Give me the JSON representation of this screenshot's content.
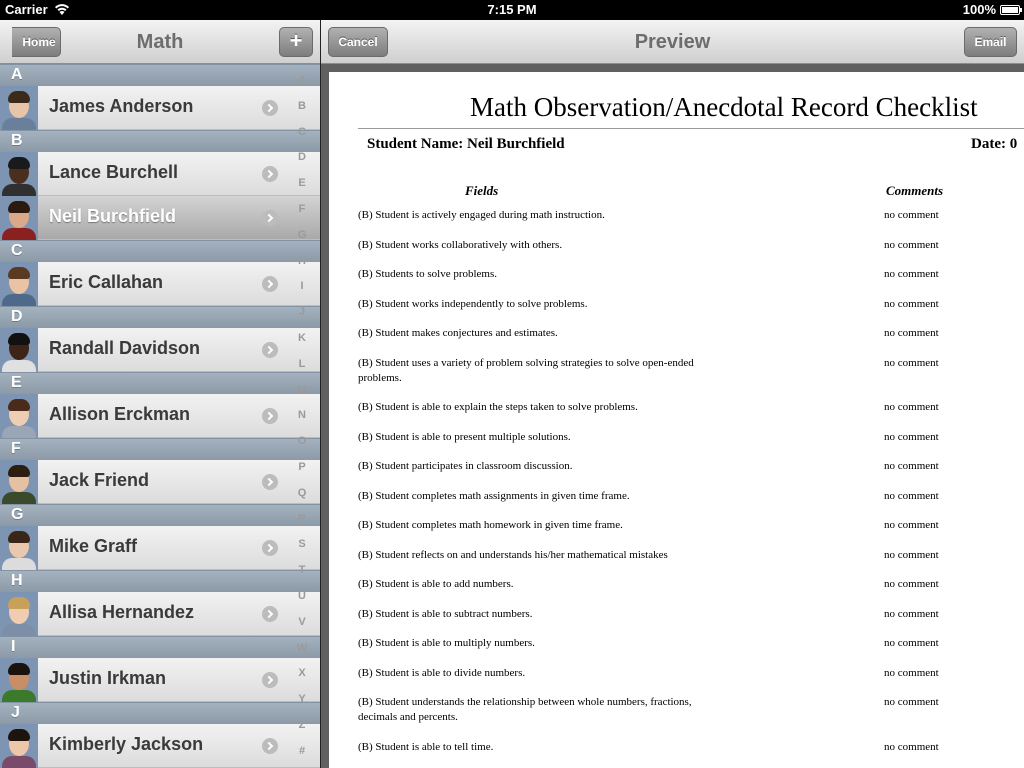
{
  "status": {
    "carrier": "Carrier",
    "time": "7:15 PM",
    "battery": "100%",
    "battery_level": 1.0
  },
  "left_nav": {
    "back_label": "Home",
    "title": "Math",
    "add_label": "+"
  },
  "sections": [
    {
      "letter": "A",
      "students": [
        {
          "name": "James Anderson",
          "skin": "#e8c5a8",
          "hair": "#3b2a1a",
          "shirt": "#6a7f9c"
        }
      ]
    },
    {
      "letter": "B",
      "students": [
        {
          "name": "Lance Burchell",
          "skin": "#4a2e1f",
          "hair": "#1a1a1a",
          "shirt": "#303030"
        },
        {
          "name": "Neil Burchfield",
          "skin": "#d9a98a",
          "hair": "#2a1a10",
          "shirt": "#8a2020",
          "selected": true
        }
      ]
    },
    {
      "letter": "C",
      "students": [
        {
          "name": "Eric Callahan",
          "skin": "#eac3a4",
          "hair": "#5a3a20",
          "shirt": "#4d6a8a"
        }
      ]
    },
    {
      "letter": "D",
      "students": [
        {
          "name": "Randall Davidson",
          "skin": "#3d2418",
          "hair": "#111111",
          "shirt": "#e0e0e0"
        }
      ]
    },
    {
      "letter": "E",
      "students": [
        {
          "name": "Allison Erckman",
          "skin": "#efcdb4",
          "hair": "#4a2a18",
          "shirt": "#9aa5b5"
        }
      ]
    },
    {
      "letter": "F",
      "students": [
        {
          "name": "Jack Friend",
          "skin": "#e6c0a2",
          "hair": "#2d1e12",
          "shirt": "#3a4a2a"
        }
      ]
    },
    {
      "letter": "G",
      "students": [
        {
          "name": "Mike Graff",
          "skin": "#eac8ae",
          "hair": "#3a2616",
          "shirt": "#dcdcdc"
        }
      ]
    },
    {
      "letter": "H",
      "students": [
        {
          "name": "Allisa Hernandez",
          "skin": "#f0cdb0",
          "hair": "#c9a05a",
          "shirt": "#7d8fa8"
        }
      ]
    },
    {
      "letter": "I",
      "students": [
        {
          "name": "Justin Irkman",
          "skin": "#c98e66",
          "hair": "#1a120c",
          "shirt": "#3a7a2a"
        }
      ]
    },
    {
      "letter": "J",
      "students": [
        {
          "name": "Kimberly Jackson",
          "skin": "#ecc7aa",
          "hair": "#1e140e",
          "shirt": "#7a4a6a"
        }
      ]
    }
  ],
  "index_letters": [
    "A",
    "B",
    "C",
    "D",
    "E",
    "F",
    "G",
    "H",
    "I",
    "J",
    "K",
    "L",
    "M",
    "N",
    "O",
    "P",
    "Q",
    "R",
    "S",
    "T",
    "U",
    "V",
    "W",
    "X",
    "Y",
    "Z",
    "#"
  ],
  "right_nav": {
    "cancel_label": "Cancel",
    "title": "Preview",
    "email_label": "Email"
  },
  "document": {
    "title": "Math Observation/Anecdotal Record Checklist",
    "student_name": "Student Name: Neil Burchfield",
    "date": "Date: 0",
    "col_fields": "Fields",
    "col_comments": "Comments",
    "items": [
      {
        "field": "(B) Student is actively engaged during math instruction.",
        "comment": "no comment"
      },
      {
        "field": "(B) Student works collaboratively with others.",
        "comment": "no comment"
      },
      {
        "field": "(B) Students to solve problems.",
        "comment": "no comment"
      },
      {
        "field": "(B) Student works independently to solve problems.",
        "comment": "no comment"
      },
      {
        "field": "(B) Student makes conjectures and estimates.",
        "comment": "no comment"
      },
      {
        "field": "(B) Student uses a variety of problem solving strategies to solve open-ended problems.",
        "comment": "no comment"
      },
      {
        "field": "(B) Student is able to explain the steps taken to solve problems.",
        "comment": "no comment"
      },
      {
        "field": "(B) Student is able to present multiple solutions.",
        "comment": "no comment"
      },
      {
        "field": "(B) Student participates in classroom discussion.",
        "comment": "no comment"
      },
      {
        "field": "(B) Student completes math assignments in given time frame.",
        "comment": "no comment"
      },
      {
        "field": "(B) Student completes math homework in given time frame.",
        "comment": "no comment"
      },
      {
        "field": "(B) Student reflects on and understands his/her mathematical mistakes",
        "comment": "no comment"
      },
      {
        "field": "(B) Student is able to add numbers.",
        "comment": "no comment"
      },
      {
        "field": "(B) Student is able to subtract numbers.",
        "comment": "no comment"
      },
      {
        "field": "(B) Student is able to multiply numbers.",
        "comment": "no comment"
      },
      {
        "field": "(B) Student is able to divide numbers.",
        "comment": "no comment"
      },
      {
        "field": "(B) Student understands the relationship between whole numbers, fractions, decimals and percents.",
        "comment": "no comment"
      },
      {
        "field": "(B) Student is able to tell time.",
        "comment": "no comment"
      }
    ]
  }
}
